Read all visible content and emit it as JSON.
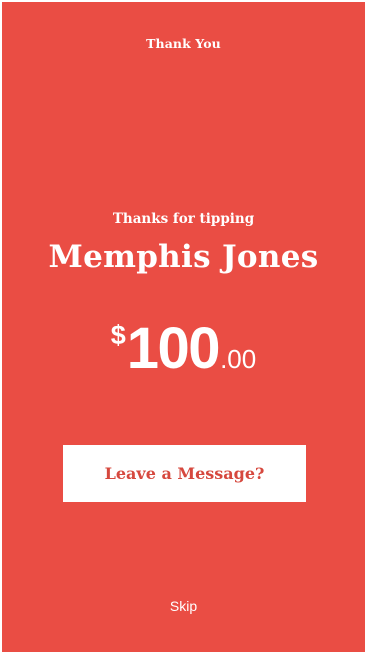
{
  "header": {
    "title": "Thank You"
  },
  "tip": {
    "thanks_text": "Thanks for tipping",
    "recipient": "Memphis Jones",
    "amount_currency": "$",
    "amount_whole": "100",
    "amount_cents": ".00"
  },
  "actions": {
    "message_label": "Leave a Message?",
    "skip_label": "Skip"
  },
  "colors": {
    "background": "#ea4d44",
    "button_text": "#d6483e",
    "text": "#ffffff"
  }
}
